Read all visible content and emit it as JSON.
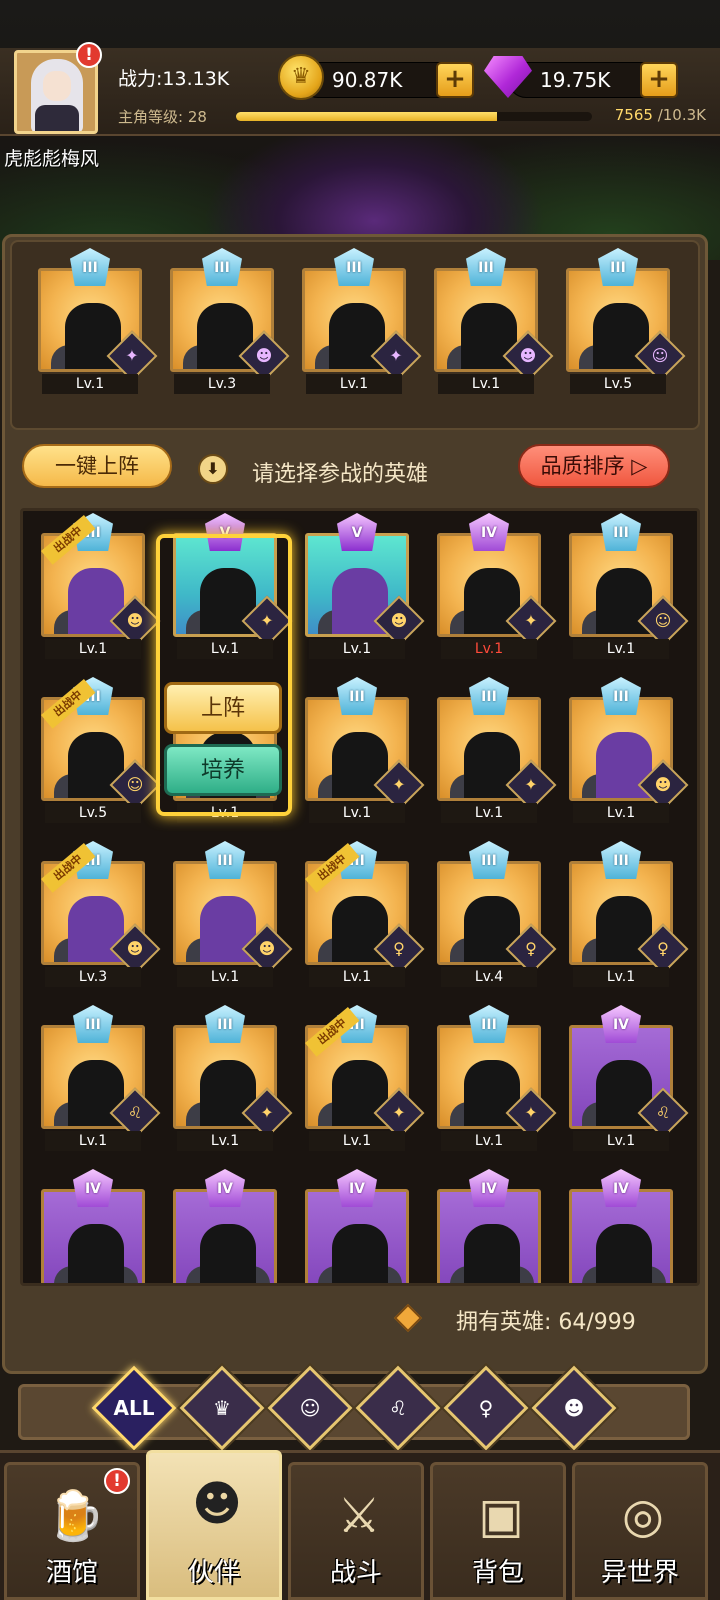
{
  "player": {
    "power_label": "战力:13.13K",
    "name": "虎彪彪梅风",
    "level_label": "主角等级: 28",
    "exp_current": "7565",
    "exp_max": " /10.3K",
    "exp_fraction": 0.734
  },
  "currency": {
    "coins": "90.87K",
    "gems": "19.75K",
    "plus": "+"
  },
  "alert_mark": "!",
  "team": [
    {
      "rank": "III",
      "level": "Lv.1",
      "faction": "✦"
    },
    {
      "rank": "III",
      "level": "Lv.3",
      "faction": "☻"
    },
    {
      "rank": "III",
      "level": "Lv.1",
      "faction": "✦"
    },
    {
      "rank": "III",
      "level": "Lv.1",
      "faction": "☻"
    },
    {
      "rank": "III",
      "level": "Lv.5",
      "faction": "☺"
    }
  ],
  "actions": {
    "auto_deploy": "一键上阵",
    "hint_icon": "⬇",
    "hint": "请选择参战的英雄",
    "sort_quality": "品质排序 ▷",
    "deploy": "上阵",
    "train": "培养"
  },
  "battle_ribbon": "出战中",
  "heroes": [
    {
      "rank": "III",
      "level": "Lv.1",
      "faction": "☻",
      "quality": "orange",
      "deployed": true
    },
    {
      "rank": "V",
      "level": "Lv.1",
      "faction": "✦",
      "quality": "teal",
      "deployed": false
    },
    {
      "rank": "V",
      "level": "Lv.1",
      "faction": "☻",
      "quality": "teal",
      "deployed": false
    },
    {
      "rank": "IV",
      "level": "Lv.1",
      "faction": "✦",
      "quality": "orange",
      "deployed": false,
      "red": true
    },
    {
      "rank": "III",
      "level": "Lv.1",
      "faction": "☺",
      "quality": "orange",
      "deployed": false
    },
    {
      "rank": "III",
      "level": "Lv.5",
      "faction": "☺",
      "quality": "orange",
      "deployed": true
    },
    {
      "rank": "",
      "level": "Lv.1",
      "faction": "",
      "quality": "orange",
      "deployed": false
    },
    {
      "rank": "III",
      "level": "Lv.1",
      "faction": "✦",
      "quality": "orange",
      "deployed": false
    },
    {
      "rank": "III",
      "level": "Lv.1",
      "faction": "✦",
      "quality": "orange",
      "deployed": false
    },
    {
      "rank": "III",
      "level": "Lv.1",
      "faction": "☻",
      "quality": "orange",
      "deployed": false
    },
    {
      "rank": "III",
      "level": "Lv.3",
      "faction": "☻",
      "quality": "orange",
      "deployed": true
    },
    {
      "rank": "III",
      "level": "Lv.1",
      "faction": "☻",
      "quality": "orange",
      "deployed": false
    },
    {
      "rank": "III",
      "level": "Lv.1",
      "faction": "♀",
      "quality": "orange",
      "deployed": true
    },
    {
      "rank": "III",
      "level": "Lv.4",
      "faction": "♀",
      "quality": "orange",
      "deployed": false
    },
    {
      "rank": "III",
      "level": "Lv.1",
      "faction": "♀",
      "quality": "orange",
      "deployed": false
    },
    {
      "rank": "III",
      "level": "Lv.1",
      "faction": "♌",
      "quality": "orange",
      "deployed": false
    },
    {
      "rank": "III",
      "level": "Lv.1",
      "faction": "✦",
      "quality": "orange",
      "deployed": false
    },
    {
      "rank": "III",
      "level": "Lv.1",
      "faction": "✦",
      "quality": "orange",
      "deployed": true
    },
    {
      "rank": "III",
      "level": "Lv.1",
      "faction": "✦",
      "quality": "orange",
      "deployed": false
    },
    {
      "rank": "IV",
      "level": "Lv.1",
      "faction": "♌",
      "quality": "purple",
      "deployed": false
    },
    {
      "rank": "IV",
      "level": "",
      "faction": "",
      "quality": "purple",
      "deployed": false
    },
    {
      "rank": "IV",
      "level": "",
      "faction": "",
      "quality": "purple",
      "deployed": false
    },
    {
      "rank": "IV",
      "level": "",
      "faction": "",
      "quality": "purple",
      "deployed": false
    },
    {
      "rank": "IV",
      "level": "",
      "faction": "",
      "quality": "purple",
      "deployed": false
    },
    {
      "rank": "IV",
      "level": "",
      "faction": "",
      "quality": "purple",
      "deployed": false
    }
  ],
  "owned": {
    "label": "拥有英雄: 64/999"
  },
  "filters": [
    {
      "label": "ALL",
      "icon": "all-filter-icon"
    },
    {
      "label": "♛",
      "icon": "crown-faction-icon"
    },
    {
      "label": "☺",
      "icon": "fish-faction-icon"
    },
    {
      "label": "♌",
      "icon": "lion-faction-icon"
    },
    {
      "label": "♀",
      "icon": "elf-faction-icon"
    },
    {
      "label": "☻",
      "icon": "demon-faction-icon"
    }
  ],
  "nav": [
    {
      "label": "酒馆",
      "glyph": "🍺"
    },
    {
      "label": "伙伴",
      "glyph": "☻"
    },
    {
      "label": "战斗",
      "glyph": "⚔"
    },
    {
      "label": "背包",
      "glyph": "▣"
    },
    {
      "label": "异世界",
      "glyph": "◎"
    }
  ]
}
